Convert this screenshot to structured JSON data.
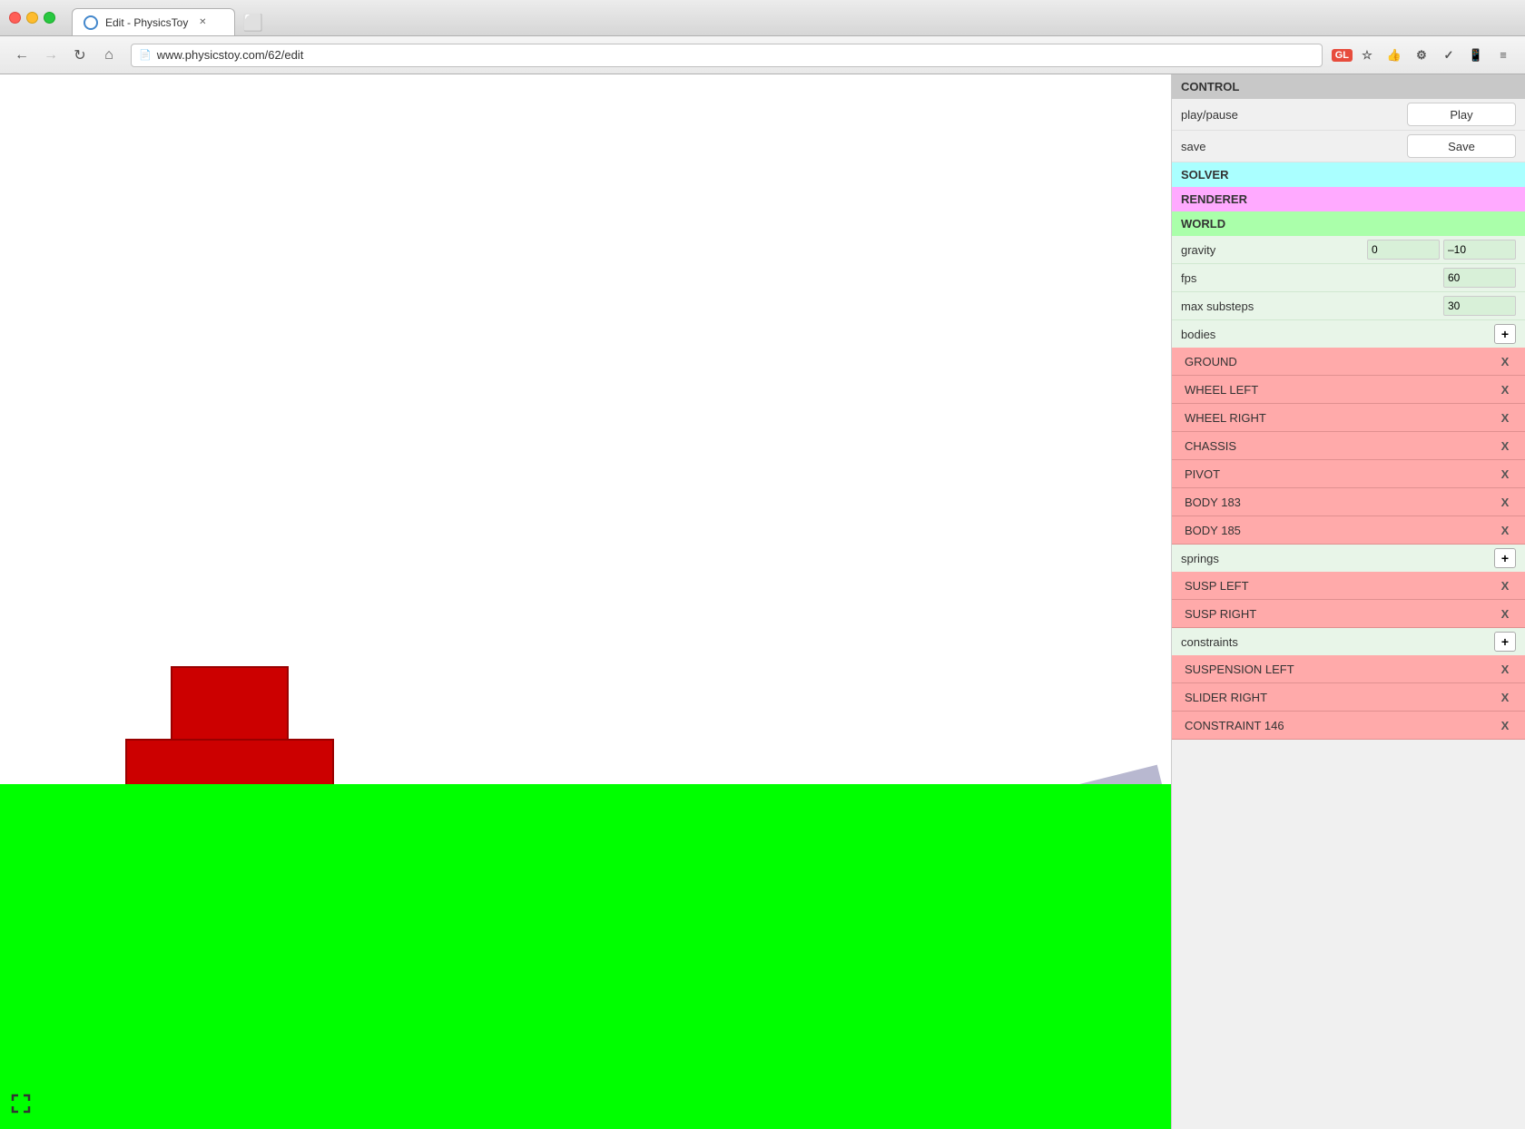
{
  "window": {
    "title": "Edit - PhysicsToy"
  },
  "browser": {
    "url": "www.physicstoy.com/62/edit",
    "back_disabled": false,
    "forward_disabled": true
  },
  "panel": {
    "control_label": "CONTROL",
    "play_label": "play/pause",
    "play_btn": "Play",
    "save_label": "save",
    "save_btn": "Save",
    "solver_label": "SOLVER",
    "renderer_label": "RENDERER",
    "world_label": "WORLD",
    "gravity_label": "gravity",
    "gravity_x": "0",
    "gravity_y": "–10",
    "fps_label": "fps",
    "fps_value": "60",
    "max_substeps_label": "max substeps",
    "max_substeps_value": "30",
    "bodies_label": "bodies",
    "add_body_btn": "+",
    "bodies": [
      {
        "name": "GROUND"
      },
      {
        "name": "WHEEL LEFT"
      },
      {
        "name": "WHEEL RIGHT"
      },
      {
        "name": "CHASSIS"
      },
      {
        "name": "PIVOT"
      },
      {
        "name": "BODY 183"
      },
      {
        "name": "BODY 185"
      }
    ],
    "springs_label": "springs",
    "add_spring_btn": "+",
    "springs": [
      {
        "name": "SUSP LEFT"
      },
      {
        "name": "SUSP RIGHT"
      }
    ],
    "constraints_label": "constraints",
    "add_constraint_btn": "+",
    "constraints": [
      {
        "name": "SUSPENSION LEFT"
      },
      {
        "name": "SLIDER RIGHT"
      },
      {
        "name": "CONSTRAINT 146"
      }
    ],
    "remove_btn": "X"
  }
}
